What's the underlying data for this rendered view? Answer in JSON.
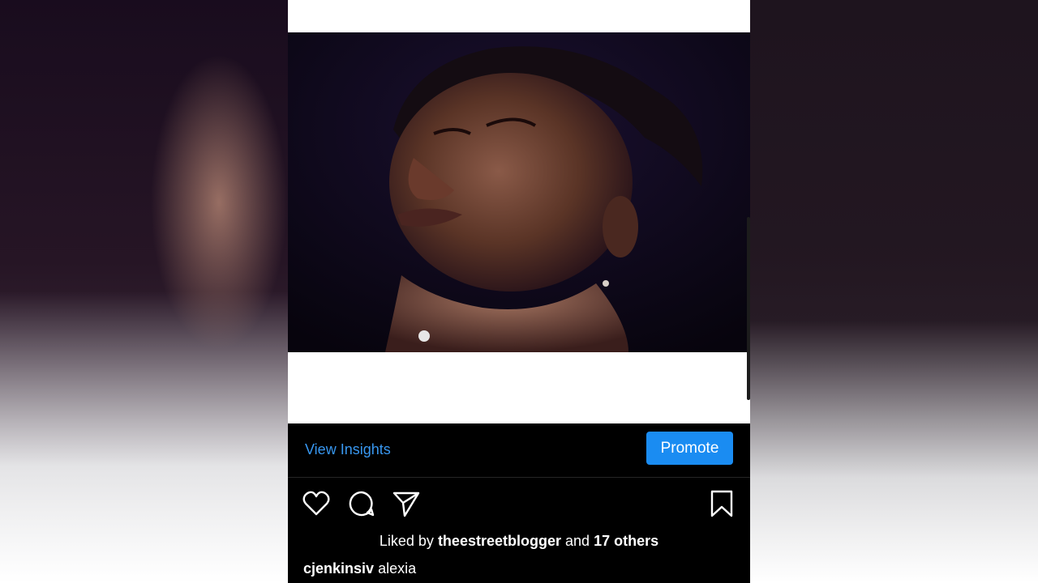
{
  "post": {
    "image_alt": "Portrait of a woman looking upward against a dark background",
    "insights_label": "View Insights",
    "promote_label": "Promote"
  },
  "actions": {
    "like_icon": "heart-icon",
    "comment_icon": "comment-bubble-icon",
    "share_icon": "send-paper-plane-icon",
    "save_icon": "bookmark-icon"
  },
  "likes": {
    "prefix": "Liked by",
    "user": "theestreetblogger",
    "middle": "and",
    "others": "17 others"
  },
  "caption": {
    "username": "cjenkinsiv",
    "text": "alexia"
  },
  "colors": {
    "accent_blue": "#1a8cf2",
    "link_blue": "#3897f0",
    "background": "#000000"
  }
}
